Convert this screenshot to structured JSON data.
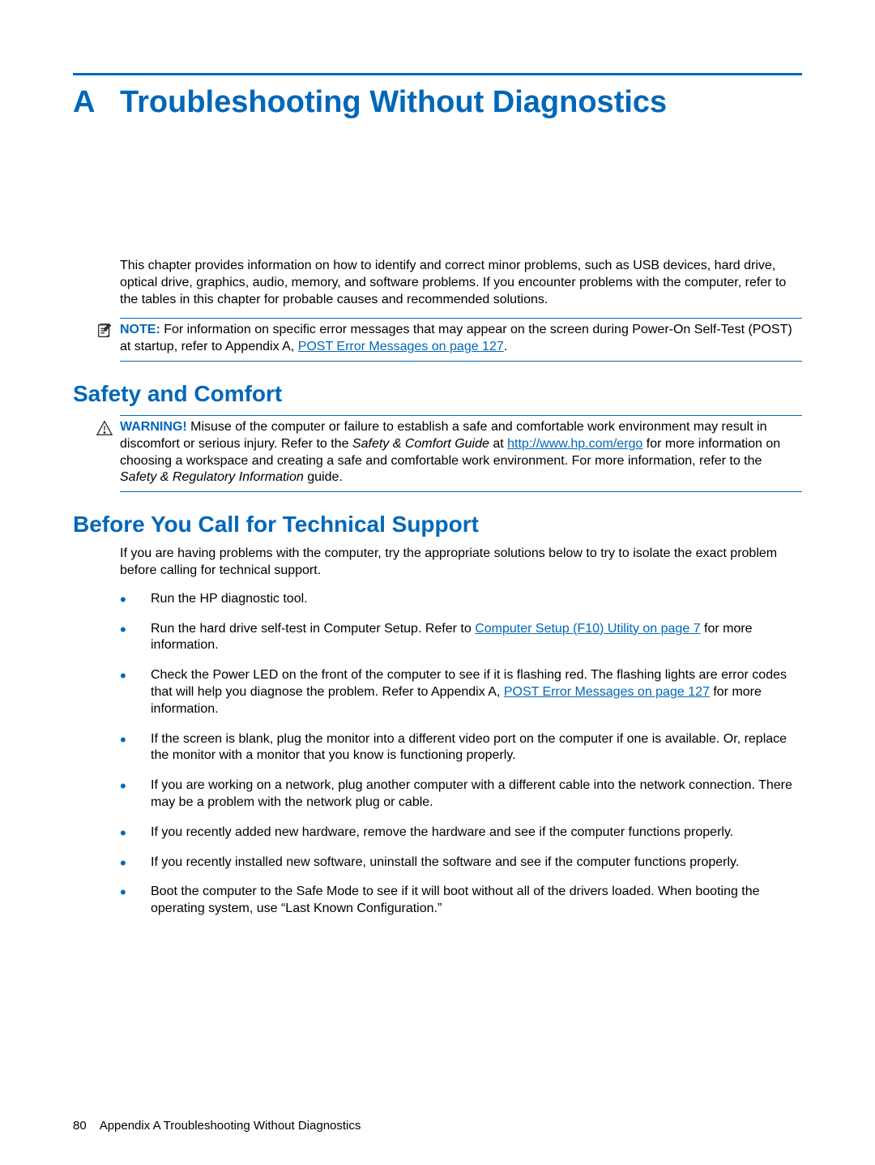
{
  "chapter": {
    "letter": "A",
    "title": "Troubleshooting Without Diagnostics"
  },
  "intro": "This chapter provides information on how to identify and correct minor problems, such as USB devices, hard drive, optical drive, graphics, audio, memory, and software problems. If you encounter problems with the computer, refer to the tables in this chapter for probable causes and recommended solutions.",
  "note": {
    "label": "NOTE:",
    "text_before_link": "For information on specific error messages that may appear on the screen during Power-On Self-Test (POST) at startup, refer to Appendix A, ",
    "link": "POST Error Messages on page 127",
    "text_after_link": "."
  },
  "safety": {
    "heading": "Safety and Comfort",
    "warning_label": "WARNING!",
    "w1": "Misuse of the computer or failure to establish a safe and comfortable work environment may result in discomfort or serious injury. Refer to the ",
    "w_italic1": "Safety & Comfort Guide",
    "w2": " at ",
    "w_link": "http://www.hp.com/ergo",
    "w3": " for more information on choosing a workspace and creating a safe and comfortable work environment. For more information, refer to the ",
    "w_italic2": "Safety & Regulatory Information",
    "w4": " guide."
  },
  "support": {
    "heading": "Before You Call for Technical Support",
    "intro": "If you are having problems with the computer, try the appropriate solutions below to try to isolate the exact problem before calling for technical support.",
    "b1": "Run the HP diagnostic tool.",
    "b2a": "Run the hard drive self-test in Computer Setup. Refer to ",
    "b2link": "Computer Setup (F10) Utility on page 7",
    "b2b": " for more information.",
    "b3a": "Check the Power LED on the front of the computer to see if it is flashing red. The flashing lights are error codes that will help you diagnose the problem. Refer to Appendix A, ",
    "b3link": "POST Error Messages on page 127",
    "b3b": " for more information.",
    "b4": "If the screen is blank, plug the monitor into a different video port on the computer if one is available. Or, replace the monitor with a monitor that you know is functioning properly.",
    "b5": "If you are working on a network, plug another computer with a different cable into the network connection. There may be a problem with the network plug or cable.",
    "b6": "If you recently added new hardware, remove the hardware and see if the computer functions properly.",
    "b7": "If you recently installed new software, uninstall the software and see if the computer functions properly.",
    "b8": "Boot the computer to the Safe Mode to see if it will boot without all of the drivers loaded. When booting the operating system, use “Last Known Configuration.”"
  },
  "footer": {
    "page_number": "80",
    "line": "Appendix A   Troubleshooting Without Diagnostics"
  }
}
